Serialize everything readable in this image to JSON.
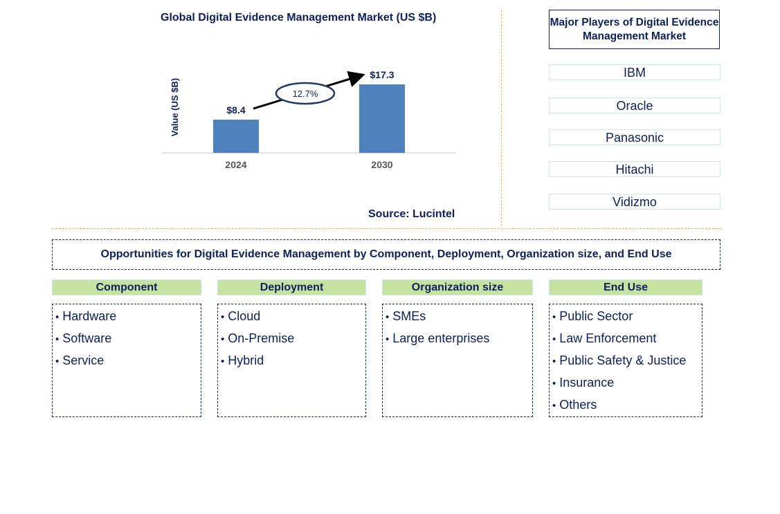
{
  "chart_data": {
    "type": "bar",
    "title": "Global Digital Evidence Management Market (US $B)",
    "xlabel": "",
    "ylabel": "Value (US $B)",
    "categories": [
      "2024",
      "2030"
    ],
    "values": [
      8.4,
      17.3
    ],
    "data_labels": [
      "$8.4",
      "$17.3"
    ],
    "annotation": {
      "type": "cagr-arrow",
      "label": "12.7%",
      "from": "2024",
      "to": "2030"
    },
    "ylim": [
      0,
      20
    ],
    "grid": false,
    "bar_color": "#4f81bd"
  },
  "source": "Source: Lucintel",
  "players": {
    "title": "Major Players of Digital Evidence Management Market",
    "items": [
      "IBM",
      "Oracle",
      "Panasonic",
      "Hitachi",
      "Vidizmo"
    ]
  },
  "opportunities": {
    "title": "Opportunities for Digital Evidence Management by Component, Deployment, Organization size, and End Use",
    "categories": [
      {
        "label": "Component",
        "items": [
          "Hardware",
          "Software",
          "Service"
        ]
      },
      {
        "label": "Deployment",
        "items": [
          "Cloud",
          "On-Premise",
          "Hybrid"
        ]
      },
      {
        "label": "Organization size",
        "items": [
          "SMEs",
          "Large enterprises"
        ]
      },
      {
        "label": "End Use",
        "items": [
          "Public Sector",
          "Law Enforcement",
          "Public Safety & Justice",
          "Insurance",
          "Others"
        ]
      }
    ]
  },
  "colors": {
    "text": "#0d2060",
    "bar": "#4f81bd",
    "category_header": "#c6e2a0",
    "divider": "#f2b632"
  }
}
